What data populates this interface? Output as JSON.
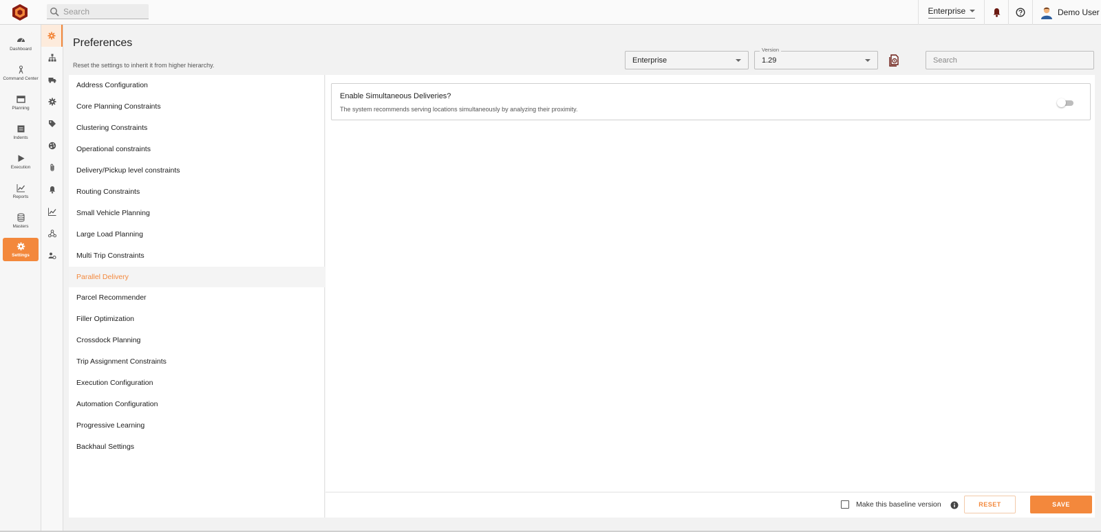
{
  "topbar": {
    "search_placeholder": "Search",
    "org_selector": "Enterprise",
    "user_name": "Demo User"
  },
  "leftnav": {
    "items": [
      {
        "label": "Dashboard",
        "icon": "dashboard-icon"
      },
      {
        "label": "Command Center",
        "icon": "command-center-icon"
      },
      {
        "label": "Planning",
        "icon": "planning-icon"
      },
      {
        "label": "Indents",
        "icon": "indents-icon"
      },
      {
        "label": "Execution",
        "icon": "play-icon"
      },
      {
        "label": "Reports",
        "icon": "chart-line-icon"
      },
      {
        "label": "Masters",
        "icon": "database-icon"
      },
      {
        "label": "Settings",
        "icon": "gear-icon"
      }
    ],
    "active": "Settings"
  },
  "header": {
    "title": "Preferences",
    "subtitle": "Reset the settings to inherit it from higher hierarchy.",
    "hierarchy_value": "Enterprise",
    "version_label": "Version",
    "version_value": "1.29",
    "search_placeholder": "Search"
  },
  "categories": [
    "Address Configuration",
    "Core Planning Constraints",
    "Clustering Constraints",
    "Operational constraints",
    "Delivery/Pickup level constraints",
    "Routing Constraints",
    "Small Vehicle Planning",
    "Large Load Planning",
    "Multi Trip Constraints",
    "Parallel Delivery",
    "Parcel Recommender",
    "Filler Optimization",
    "Crossdock Planning",
    "Trip Assignment Constraints",
    "Execution Configuration",
    "Automation Configuration",
    "Progressive Learning",
    "Backhaul Settings"
  ],
  "active_category": "Parallel Delivery",
  "setting": {
    "title": "Enable Simultaneous Deliveries?",
    "description": "The system recommends serving locations simultaneously by analyzing their proximity.",
    "enabled": false
  },
  "footer": {
    "baseline_label": "Make this baseline version",
    "reset_label": "RESET",
    "save_label": "SAVE"
  },
  "colors": {
    "accent": "#f3883c",
    "logo_dark": "#8a1c12"
  }
}
